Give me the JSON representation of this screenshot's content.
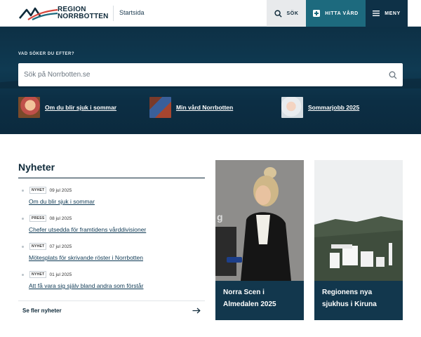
{
  "header": {
    "brand_line1": "REGION",
    "brand_line2": "NORRBOTTEN",
    "startsida": "Startsida",
    "sok_label": "SÖK",
    "hitta_vard_label": "HITTA VÅRD",
    "meny_label": "MENY"
  },
  "hero": {
    "search_label": "VAD SÖKER DU EFTER?",
    "search_placeholder": "Sök på Norrbotten.se",
    "quick_links": [
      {
        "label": "Om du blir sjuk i sommar"
      },
      {
        "label": "Min vård Norrbotten"
      },
      {
        "label": "Sommarjobb 2025"
      }
    ]
  },
  "news": {
    "heading": "Nyheter",
    "items": [
      {
        "tag": "NYHET",
        "date": "09 jul 2025",
        "title": "Om du blir sjuk i sommar"
      },
      {
        "tag": "PRESS",
        "date": "08 jul 2025",
        "title": "Chefer utsedda för framtidens vårddivisioner"
      },
      {
        "tag": "NYHET",
        "date": "07 jul 2025",
        "title": "Mötesplats för skrivande röster i Norrbotten"
      },
      {
        "tag": "NYHET",
        "date": "01 jul 2025",
        "title": "Att få vara sig själv bland andra som förstår"
      }
    ],
    "more_label": "Se fler nyheter"
  },
  "cards": [
    {
      "line1": "Norra Scen i",
      "line2": "Almedalen 2025"
    },
    {
      "line1": "Regionens nya",
      "line2": "sjukhus i Kiruna"
    }
  ],
  "colors": {
    "navy": "#0e3147",
    "teal": "#1d6a7e",
    "hero": "#0f3a52"
  }
}
